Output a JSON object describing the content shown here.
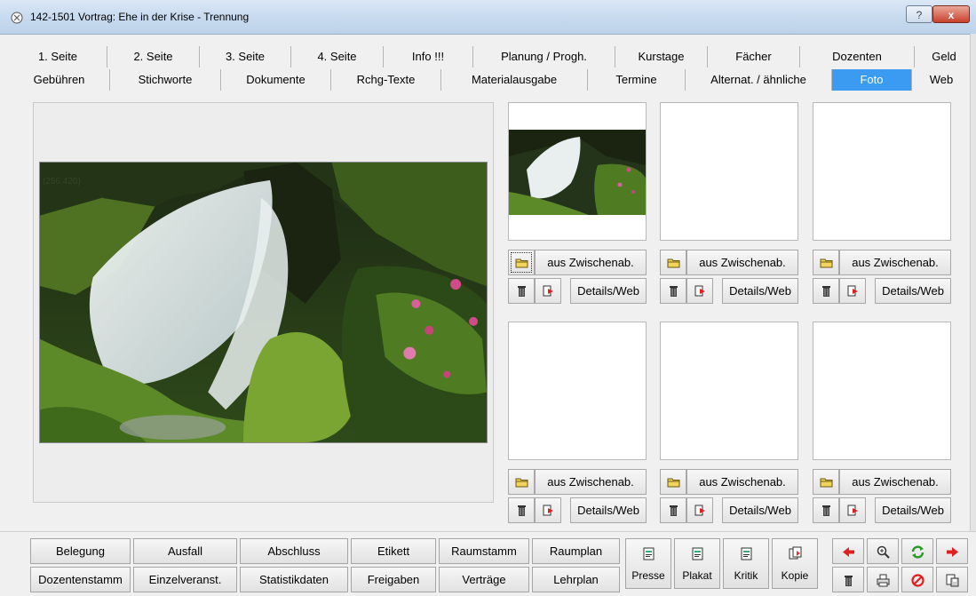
{
  "window": {
    "title": "142-1501 Vortrag: Ehe in der Krise - Trennung",
    "help": "?",
    "close": "x"
  },
  "tabs_row1": [
    "1. Seite",
    "2. Seite",
    "3. Seite",
    "4. Seite",
    "Info !!!",
    "Planung / Progh.",
    "Kurstage",
    "Fächer",
    "Dozenten",
    "Geld"
  ],
  "tabs_row2": [
    "Gebühren",
    "Stichworte",
    "Dokumente",
    "Rchg-Texte",
    "Materialausgabe",
    "Termine",
    "Alternat. / ähnliche",
    "Foto",
    "Web"
  ],
  "active_tab": "Foto",
  "photo": {
    "coord_readout": "(256.420)"
  },
  "slot_buttons": {
    "clipboard": "aus Zwischenab.",
    "details": "Details/Web"
  },
  "bottom": {
    "row1": [
      "Belegung",
      "Ausfall",
      "Abschluss",
      "Etikett",
      "Raumstamm",
      "Raumplan"
    ],
    "row2": [
      "Dozentenstamm",
      "Einzelveranst.",
      "Statistikdaten",
      "Freigaben",
      "Verträge",
      "Lehrplan"
    ],
    "big": [
      "Presse",
      "Plakat",
      "Kritik",
      "Kopie"
    ]
  },
  "icons": [
    "open-folder-icon",
    "trash-icon",
    "export-arrow-icon",
    "arrow-left-icon",
    "zoom-icon",
    "refresh-icon",
    "arrow-right-icon",
    "printer-icon",
    "cancel-icon",
    "save-copy-icon",
    "doc-icon"
  ],
  "colors": {
    "active_tab": "#3a9bf0",
    "titlebar": "#c6d9ee"
  }
}
